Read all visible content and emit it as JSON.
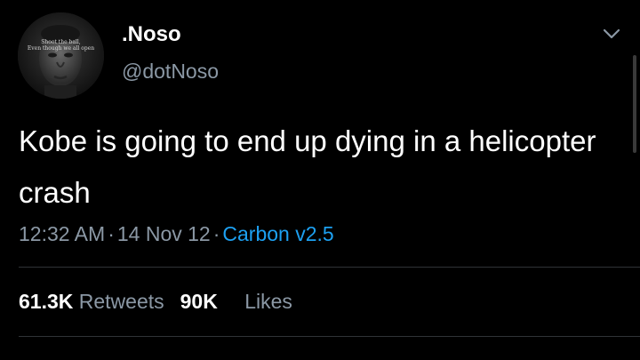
{
  "author": {
    "display_name": ".Noso",
    "handle": "@dotNoso",
    "avatar_caption_line1": "Shoot the ball,",
    "avatar_caption_line2": "Even though we all open"
  },
  "tweet": {
    "text": "Kobe is going to end up dying in a helicopter crash",
    "time": "12:32 AM",
    "date": "14 Nov 12",
    "separator": "·",
    "source": "Carbon v2.5"
  },
  "stats": {
    "retweets_count": "61.3K",
    "retweets_label": "Retweets",
    "likes_count": "90K",
    "likes_label": "Likes"
  },
  "icons": {
    "menu": "chevron-down-icon"
  },
  "colors": {
    "background": "#000000",
    "secondary_text": "#8b98a5",
    "link": "#1da1f2"
  }
}
